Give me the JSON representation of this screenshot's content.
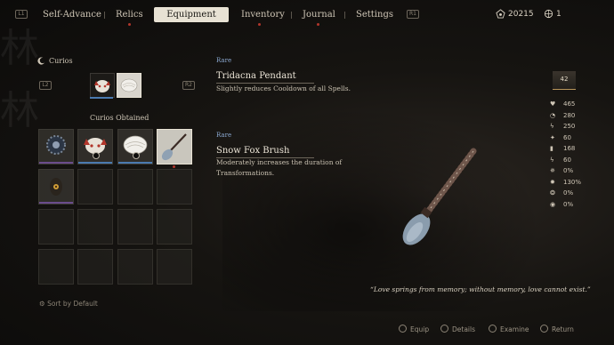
{
  "nav": {
    "left_key": "L1",
    "right_key": "R1",
    "tabs": [
      {
        "label": "Self-Advance"
      },
      {
        "label": "Relics"
      },
      {
        "label": "Equipment"
      },
      {
        "label": "Inventory"
      },
      {
        "label": "Journal"
      },
      {
        "label": "Settings"
      }
    ],
    "currency_will": "20215",
    "currency_spark": "1"
  },
  "curios": {
    "title": "Curios",
    "obtained_label": "Curios Obtained",
    "sort_label": "Sort by Default",
    "tab_left_key": "L2",
    "tab_right_key": "R2"
  },
  "selected_item": {
    "rarity": "Rare",
    "name": "Tridacna Pendant",
    "description": "Slightly reduces Cooldown of all Spells."
  },
  "hovered_item": {
    "rarity": "Rare",
    "name": "Snow Fox Brush",
    "description": "Moderately increases the duration of Transformations.",
    "quote": "“Love springs from memory; without memory, love cannot exist.”"
  },
  "stats": {
    "level": "42",
    "rows": [
      {
        "icon": "heart-icon",
        "glyph": "♥",
        "value": "465"
      },
      {
        "icon": "mana-icon",
        "glyph": "◔",
        "value": "280"
      },
      {
        "icon": "stamina-icon",
        "glyph": "ϟ",
        "value": "250"
      },
      {
        "icon": "attack-icon",
        "glyph": "✦",
        "value": "60"
      },
      {
        "icon": "defense-icon",
        "glyph": "▮",
        "value": "168"
      },
      {
        "icon": "critical-icon",
        "glyph": "ϟ",
        "value": "60"
      },
      {
        "icon": "crit-chance-icon",
        "glyph": "✵",
        "value": "0%"
      },
      {
        "icon": "crit-damage-icon",
        "glyph": "✹",
        "value": "130%"
      },
      {
        "icon": "resist-icon",
        "glyph": "❂",
        "value": "0%"
      },
      {
        "icon": "evade-icon",
        "glyph": "◉",
        "value": "0%"
      }
    ]
  },
  "hints": {
    "equip": "Equip",
    "details": "Details",
    "examine": "Examine",
    "return": "Return"
  },
  "colors": {
    "accent_red": "#b2362b",
    "rarity_blue": "#8aa7cf",
    "purple_bar": "#6a4c8c",
    "blue_bar": "#4a7ab0"
  }
}
